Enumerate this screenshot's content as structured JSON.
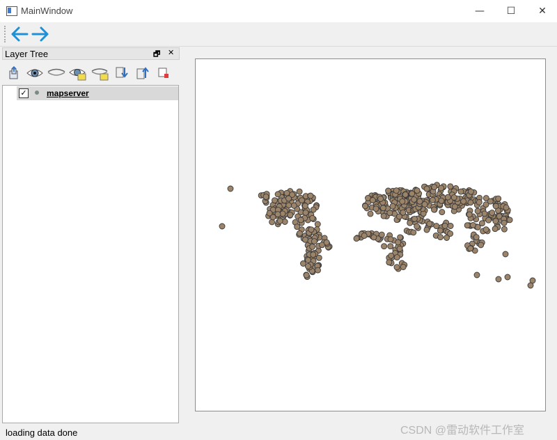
{
  "window": {
    "title": "MainWindow",
    "minimize": "—",
    "maximize": "☐",
    "close": "✕"
  },
  "toolbar": {
    "back_icon": "arrow-left-icon",
    "forward_icon": "arrow-right-icon",
    "accent": "#1e90d8"
  },
  "layer_panel": {
    "title": "Layer Tree",
    "float_glyph": "🗗",
    "close_glyph": "✕",
    "tools": [
      "add-layer-icon",
      "show-layer-icon",
      "hide-layer-icon",
      "show-all-icon",
      "hide-all-icon",
      "move-down-icon",
      "move-up-icon",
      "remove-layer-icon"
    ],
    "layers": [
      {
        "name": "mapserver",
        "checked": true,
        "check_glyph": "✓"
      }
    ]
  },
  "map": {
    "point_color": "#9b8469",
    "point_stroke": "#3a3a3a"
  },
  "status": {
    "text": "loading data done"
  },
  "watermark": "CSDN @雷动软件工作室"
}
